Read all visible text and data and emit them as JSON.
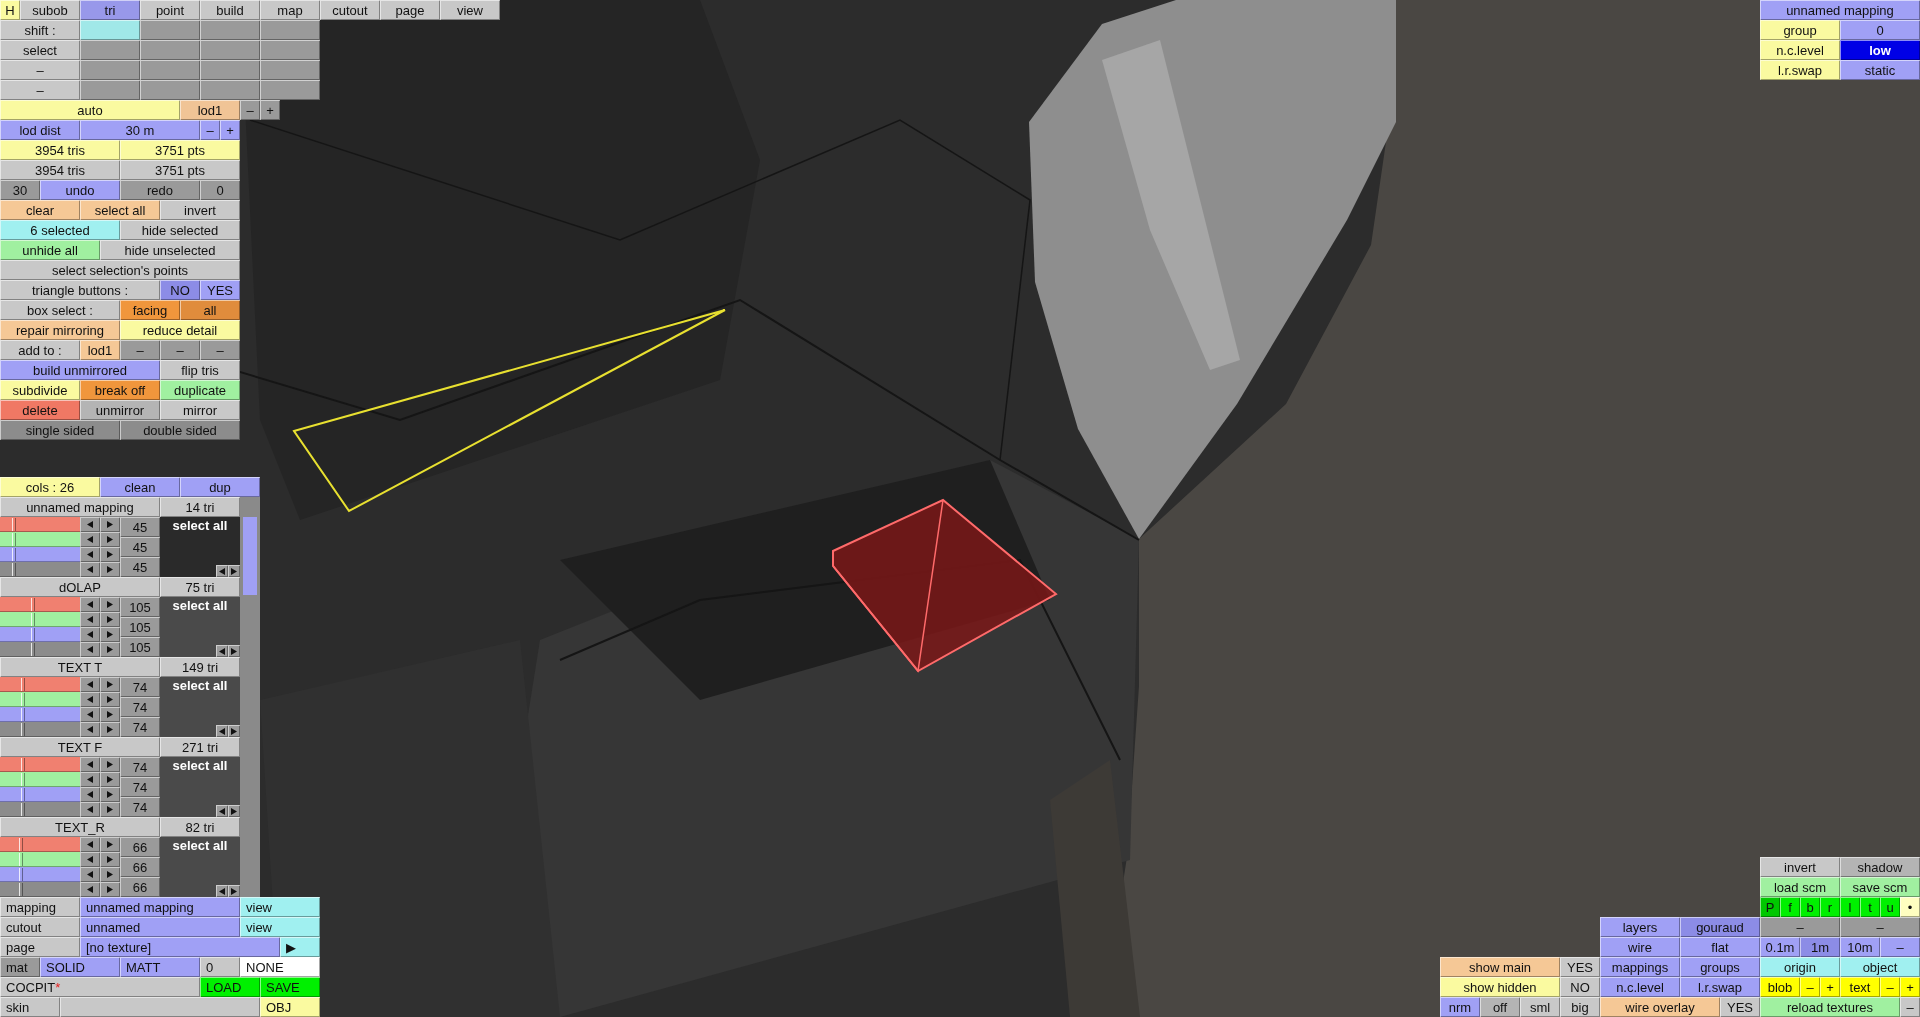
{
  "main_panel": {
    "tabs": [
      {
        "label": "H",
        "color": "#fafaa0"
      },
      {
        "label": "subob",
        "color": "#c8c8c8"
      },
      {
        "label": "tri",
        "color": "#9898ea"
      },
      {
        "label": "point",
        "color": "#c8c8c8"
      },
      {
        "label": "build",
        "color": "#c8c8c8"
      },
      {
        "label": "map",
        "color": "#c8c8c8"
      },
      {
        "label": "cutout",
        "color": "#c8c8c8"
      },
      {
        "label": "page",
        "color": "#c8c8c8"
      },
      {
        "label": "view",
        "color": "#c8c8c8"
      }
    ],
    "bars": [
      [
        {
          "label": "shift :",
          "color": "#c8c8c8"
        },
        {
          "color": "#a0e8e8"
        },
        {
          "color": "#9a9a9a"
        },
        {
          "color": "#9a9a9a"
        },
        {
          "color": "#9a9a9a"
        }
      ],
      [
        {
          "label": "select",
          "color": "#c8c8c8"
        },
        {
          "color": "#9a9a9a"
        },
        {
          "color": "#9a9a9a"
        },
        {
          "color": "#9a9a9a"
        },
        {
          "color": "#9a9a9a"
        }
      ],
      [
        {
          "label": "–",
          "color": "#c8c8c8"
        },
        {
          "color": "#9a9a9a"
        },
        {
          "color": "#9a9a9a"
        },
        {
          "color": "#9a9a9a"
        },
        {
          "color": "#9a9a9a"
        }
      ],
      [
        {
          "label": "–",
          "color": "#c8c8c8"
        },
        {
          "color": "#9a9a9a"
        },
        {
          "color": "#9a9a9a"
        },
        {
          "color": "#9a9a9a"
        },
        {
          "color": "#9a9a9a"
        }
      ],
      [
        {
          "label": "auto",
          "color": "#fafaa0"
        },
        {
          "label": "lod1",
          "color": "#f0c496"
        },
        {
          "label": "–",
          "color": "#9a9a9a"
        },
        {
          "label": "+",
          "color": "#9a9a9a"
        }
      ],
      [
        {
          "label": "lod dist",
          "color": "#a0a0f5"
        },
        {
          "label": "30 m",
          "color": "#a0a0f5"
        },
        {
          "label": "–",
          "color": "#a0a0f5"
        },
        {
          "label": "+",
          "color": "#a0a0f5"
        }
      ],
      [
        {
          "label": "3954 tris",
          "color": "#fafaa0"
        },
        {
          "label": "3751 pts",
          "color": "#fafaa0"
        }
      ],
      [
        {
          "label": "3954 tris",
          "color": "#c8c8c8"
        },
        {
          "label": "3751 pts",
          "color": "#c8c8c8"
        }
      ],
      [
        {
          "label": "30",
          "color": "#9a9a9a"
        },
        {
          "label": "undo",
          "color": "#a0a0f5"
        },
        {
          "label": "redo",
          "color": "#9a9a9a"
        },
        {
          "label": "0",
          "color": "#9a9a9a"
        }
      ],
      [
        {
          "label": "clear",
          "color": "#f5c896"
        },
        {
          "label": "select all",
          "color": "#f5c896"
        },
        {
          "label": "invert",
          "color": "#c8c8c8"
        }
      ],
      [
        {
          "label": "6 selected",
          "color": "#a0f0f0"
        },
        {
          "label": "hide selected",
          "color": "#c8c8c8"
        }
      ],
      [
        {
          "label": "unhide all",
          "color": "#a0f0a0"
        },
        {
          "label": "hide unselected",
          "color": "#c8c8c8"
        }
      ],
      [
        {
          "label": "select selection's points",
          "color": "#c8c8c8"
        }
      ],
      [
        {
          "label": "triangle buttons :",
          "color": "#c8c8c8"
        },
        {
          "label": "NO",
          "color": "#8c8ce6"
        },
        {
          "label": "YES",
          "color": "#a0a0f5"
        }
      ],
      [
        {
          "label": "box select :",
          "color": "#c8c8c8"
        },
        {
          "label": "facing",
          "color": "#f0963c"
        },
        {
          "label": "all",
          "color": "#e08c3c"
        }
      ],
      [
        {
          "label": "repair mirroring",
          "color": "#f5c896"
        },
        {
          "label": "reduce detail",
          "color": "#fafaa0"
        }
      ],
      [
        {
          "label": "add to :",
          "color": "#c8c8c8"
        },
        {
          "label": "lod1",
          "color": "#f5c896"
        },
        {
          "label": "–",
          "color": "#9a9a9a"
        },
        {
          "label": "–",
          "color": "#9a9a9a"
        },
        {
          "label": "–",
          "color": "#9a9a9a"
        }
      ],
      [
        {
          "label": "build unmirrored",
          "color": "#a0a0f5"
        },
        {
          "label": "flip tris",
          "color": "#c8c8c8"
        }
      ],
      [
        {
          "label": "subdivide",
          "color": "#fafaa0"
        },
        {
          "label": "break off",
          "color": "#f0963c"
        },
        {
          "label": "duplicate",
          "color": "#a0f0a0"
        }
      ],
      [
        {
          "label": "delete",
          "color": "#f07864"
        },
        {
          "label": "unmirror",
          "color": "#b4b4b4"
        },
        {
          "label": "mirror",
          "color": "#c8c8c8"
        }
      ],
      [
        {
          "label": "single sided",
          "color": "#8c8c8c"
        },
        {
          "label": "double sided",
          "color": "#8c8c8c"
        }
      ]
    ]
  },
  "columns_panel": {
    "header": [
      {
        "label": "cols : 26",
        "color": "#fafaa0"
      },
      {
        "label": "clean",
        "color": "#a0a0f5"
      },
      {
        "label": "dup",
        "color": "#a0a0f5"
      }
    ],
    "groups": [
      {
        "name": "unnamed mapping",
        "count": "14 tri",
        "selected": true,
        "action": "select all",
        "values": [
          "45",
          "45",
          "45"
        ],
        "sliders": [
          {
            "color": "#f08070",
            "level": 0.18
          },
          {
            "color": "#a0f0a0",
            "level": 0.18
          },
          {
            "color": "#a0a0f5",
            "level": 0.18
          },
          {
            "color": "#8c8c8c",
            "level": 0.18
          }
        ]
      },
      {
        "name": "dOLAP",
        "count": "75 tri",
        "selected": false,
        "action": "select all",
        "values": [
          "105",
          "105",
          "105"
        ],
        "sliders": [
          {
            "color": "#f08070",
            "level": 0.41
          },
          {
            "color": "#a0f0a0",
            "level": 0.41
          },
          {
            "color": "#a0a0f5",
            "level": 0.41
          },
          {
            "color": "#8c8c8c",
            "level": 0.41
          }
        ]
      },
      {
        "name": "TEXT T",
        "count": "149 tri",
        "selected": false,
        "action": "select all",
        "values": [
          "74",
          "74",
          "74"
        ],
        "sliders": [
          {
            "color": "#f08070",
            "level": 0.29
          },
          {
            "color": "#a0f0a0",
            "level": 0.29
          },
          {
            "color": "#a0a0f5",
            "level": 0.29
          },
          {
            "color": "#8c8c8c",
            "level": 0.29
          }
        ]
      },
      {
        "name": "TEXT F",
        "count": "271 tri",
        "selected": false,
        "action": "select all",
        "values": [
          "74",
          "74",
          "74"
        ],
        "sliders": [
          {
            "color": "#f08070",
            "level": 0.29
          },
          {
            "color": "#a0f0a0",
            "level": 0.29
          },
          {
            "color": "#a0a0f5",
            "level": 0.29
          },
          {
            "color": "#8c8c8c",
            "level": 0.29
          }
        ]
      },
      {
        "name": "TEXT_R",
        "count": "82 tri",
        "selected": false,
        "action": "select all",
        "values": [
          "66",
          "66",
          "66"
        ],
        "sliders": [
          {
            "color": "#f08070",
            "level": 0.26
          },
          {
            "color": "#a0f0a0",
            "level": 0.26
          },
          {
            "color": "#a0a0f5",
            "level": 0.26
          },
          {
            "color": "#8c8c8c",
            "level": 0.26
          }
        ]
      }
    ]
  },
  "material_panel": {
    "bars": [
      [
        {
          "label": "mapping",
          "color": "#c8c8c8"
        },
        {
          "label": "unnamed mapping",
          "color": "#a0a0f5"
        },
        {
          "label": "view",
          "color": "#a0f0f0"
        }
      ],
      [
        {
          "label": "cutout",
          "color": "#c8c8c8"
        },
        {
          "label": "unnamed",
          "color": "#a0a0f5"
        },
        {
          "label": "view",
          "color": "#a0f0f0"
        }
      ],
      [
        {
          "label": "page",
          "color": "#c8c8c8"
        },
        {
          "label": "[no texture]",
          "color": "#a0a0f5"
        },
        {
          "label": "▶",
          "color": "#a0f0f0"
        }
      ],
      [
        {
          "label": "mat",
          "color": "#9a9a9a"
        },
        {
          "label": "SOLID",
          "color": "#a0a0f5"
        },
        {
          "label": "MATT",
          "color": "#a0a0f5"
        },
        {
          "label": "0",
          "color": "#c8c8c8"
        },
        {
          "label": "NONE",
          "color": "#ffffff"
        }
      ],
      [
        {
          "label": "COCPIT",
          "suffix": "*",
          "color": "#c8c8c8"
        },
        {
          "label": "LOAD",
          "color": "#00f000"
        },
        {
          "label": "SAVE",
          "color": "#00f000"
        }
      ],
      [
        {
          "label": "skin",
          "color": "#c8c8c8"
        },
        {
          "color": "#c8c8c8"
        },
        {
          "label": "OBJ",
          "color": "#fafaa0"
        }
      ]
    ]
  },
  "mapping_info": {
    "bars": [
      [
        {
          "label": "unnamed mapping",
          "color": "#a0a0f5"
        }
      ],
      [
        {
          "label": "group",
          "color": "#fafaa0"
        },
        {
          "label": "0",
          "color": "#a0a0f5"
        }
      ],
      [
        {
          "label": "n.c.level",
          "color": "#fafaa0"
        },
        {
          "label": "low",
          "color": "#0000e6"
        }
      ],
      [
        {
          "label": "l.r.swap",
          "color": "#fafaa0"
        },
        {
          "label": "static",
          "color": "#a0a0f5"
        }
      ]
    ]
  },
  "view_panel": {
    "bars": [
      [
        {
          "label": "invert",
          "color": "#c8c8c8"
        },
        {
          "label": "shadow",
          "color": "#b4b4b4"
        }
      ],
      [
        {
          "label": "load scm",
          "color": "#a0f0a0"
        },
        {
          "label": "save scm",
          "color": "#a0f0a0"
        }
      ],
      [
        {
          "label": "P",
          "color": "#00c800"
        },
        {
          "label": "f",
          "color": "#00f000"
        },
        {
          "label": "b",
          "color": "#00f000"
        },
        {
          "label": "r",
          "color": "#00f000"
        },
        {
          "label": "l",
          "color": "#00f000"
        },
        {
          "label": "t",
          "color": "#00f000"
        },
        {
          "label": "u",
          "color": "#00f000"
        },
        {
          "label": "•",
          "color": "#ffffc0"
        }
      ],
      [
        {
          "label": "layers",
          "color": "#a0a0f5"
        },
        {
          "label": "gouraud",
          "color": "#8c8ce6"
        },
        {
          "label": "–",
          "color": "#9a9a9a"
        },
        {
          "label": "–",
          "color": "#9a9a9a"
        }
      ],
      [
        {
          "label": "wire",
          "color": "#a0a0f5"
        },
        {
          "label": "flat",
          "color": "#a0a0f5"
        },
        {
          "label": "0.1m",
          "color": "#a0a0f5"
        },
        {
          "label": "1m",
          "color": "#8c8ce6"
        },
        {
          "label": "10m",
          "color": "#a0a0f5"
        },
        {
          "label": "–",
          "color": "#a0a0f5"
        }
      ],
      [
        {
          "label": "show main",
          "color": "#f5c896"
        },
        {
          "label": "YES",
          "color": "#c8c8c8"
        },
        {
          "label": "mappings",
          "color": "#a0a0f5"
        },
        {
          "label": "groups",
          "color": "#a0a0f5"
        },
        {
          "label": "origin",
          "color": "#a0f0f0"
        },
        {
          "label": "object",
          "color": "#a0f0f0"
        }
      ],
      [
        {
          "label": "show hidden",
          "color": "#fafaa0"
        },
        {
          "label": "NO",
          "color": "#c8c8c8"
        },
        {
          "label": "n.c.level",
          "color": "#a0a0f5"
        },
        {
          "label": "l.r.swap",
          "color": "#a0a0f5"
        },
        {
          "label": "blob",
          "color": "#ffff00"
        },
        {
          "label": "–",
          "color": "#ffff00"
        },
        {
          "label": "+",
          "color": "#ffff00"
        },
        {
          "label": "text",
          "color": "#ffff00"
        },
        {
          "label": "–",
          "color": "#ffff00"
        },
        {
          "label": "+",
          "color": "#ffff00"
        }
      ],
      [
        {
          "label": "nrm",
          "color": "#a0a0f5"
        },
        {
          "label": "off",
          "color": "#b4b4b4"
        },
        {
          "label": "sml",
          "color": "#c8c8c8"
        },
        {
          "label": "big",
          "color": "#c8c8c8"
        },
        {
          "label": "wire overlay",
          "color": "#f5c896"
        },
        {
          "label": "YES",
          "color": "#c8c8c8"
        },
        {
          "label": "reload textures",
          "color": "#a0f0a0"
        },
        {
          "label": "–",
          "color": "#c8c8c8"
        }
      ]
    ]
  }
}
